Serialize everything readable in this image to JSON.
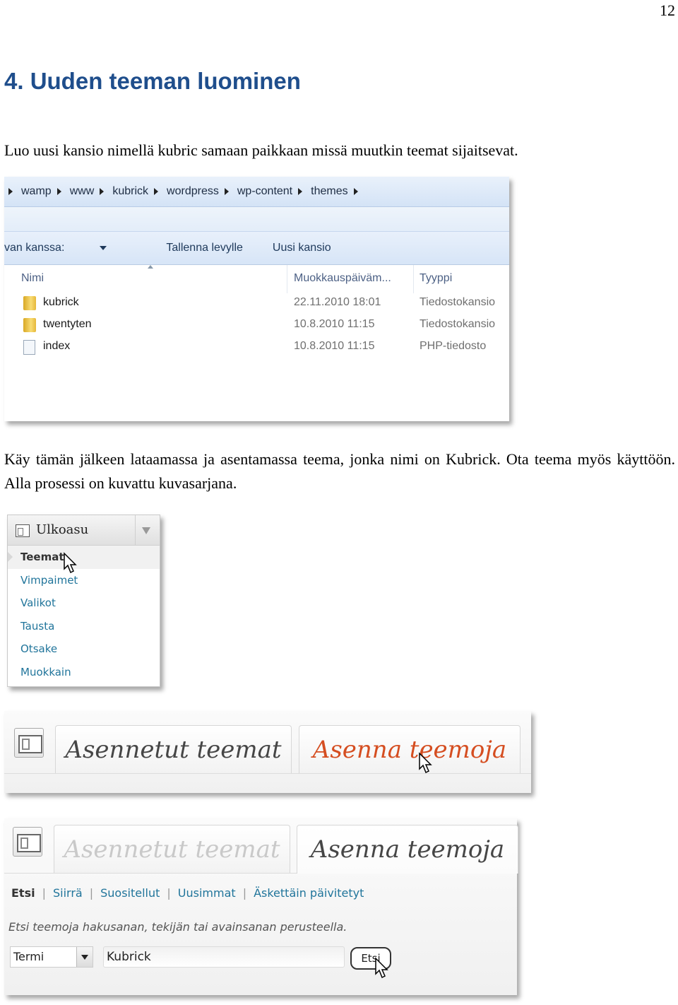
{
  "page_number": "12",
  "heading": "4. Uuden teeman luominen",
  "paragraph1": "Luo uusi kansio nimellä kubric samaan paikkaan missä muutkin teemat sijaitsevat.",
  "paragraph2": "Käy tämän jälkeen lataamassa ja asentamassa teema, jonka nimi on Kubrick. Ota teema myös käyttöön. Alla prosessi on kuvattu kuvasarjana.",
  "explorer": {
    "breadcrumb": [
      "wamp",
      "www",
      "kubrick",
      "wordpress",
      "wp-content",
      "themes"
    ],
    "toolbar": {
      "share": "van kanssa:",
      "burn": "Tallenna levylle",
      "new_folder": "Uusi kansio"
    },
    "columns": {
      "name": "Nimi",
      "date": "Muokkauspäiväm...",
      "type": "Tyyppi"
    },
    "files": [
      {
        "name": "kubrick",
        "date": "22.11.2010 18:01",
        "type": "Tiedostokansio",
        "icon": "folder-icon"
      },
      {
        "name": "twentyten",
        "date": "10.8.2010 11:15",
        "type": "Tiedostokansio",
        "icon": "folder-icon"
      },
      {
        "name": "index",
        "date": "10.8.2010 11:15",
        "type": "PHP-tiedosto",
        "icon": "php-file-icon"
      }
    ]
  },
  "appearance_menu": {
    "title": "Ulkoasu",
    "items": [
      "Teemat",
      "Vimpaimet",
      "Valikot",
      "Tausta",
      "Otsake",
      "Muokkain"
    ]
  },
  "themes_tabs": {
    "installed": "Asennetut teemat",
    "install": "Asenna teemoja"
  },
  "install_search": {
    "subnav": [
      "Etsi",
      "Siirrä",
      "Suositellut",
      "Uusimmat",
      "Äskettäin päivitetyt"
    ],
    "hint": "Etsi teemoja hakusanan, tekijän tai avainsanan perusteella.",
    "select_value": "Termi",
    "input_value": "Kubrick",
    "button": "Etsi"
  },
  "colors": {
    "heading": "#1f4e8c",
    "wp_link": "#21759b",
    "wp_orange": "#d54e21"
  }
}
